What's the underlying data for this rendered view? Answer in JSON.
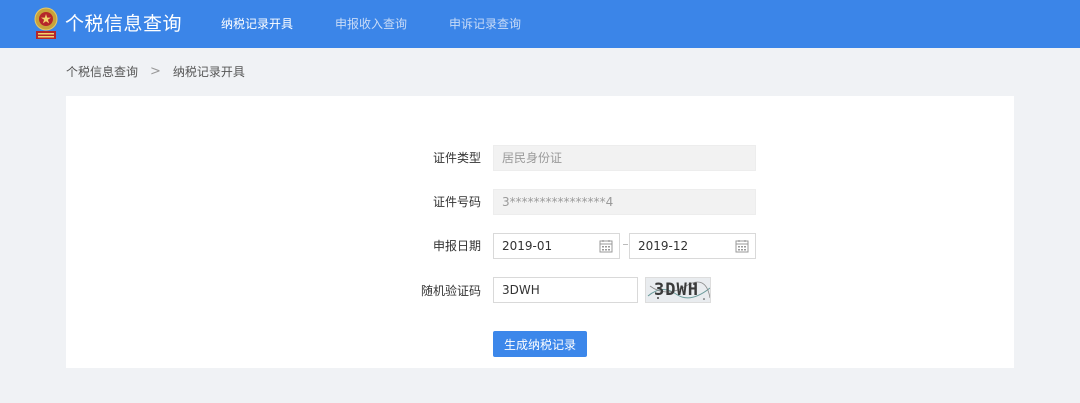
{
  "header": {
    "app_title": "个税信息查询",
    "nav": [
      {
        "label": "纳税记录开具",
        "active": true
      },
      {
        "label": "申报收入查询",
        "active": false
      },
      {
        "label": "申诉记录查询",
        "active": false
      }
    ],
    "logo_icon": "tax-emblem-icon",
    "bar_color": "#3b85e8"
  },
  "breadcrumb": {
    "items": [
      "个税信息查询",
      "纳税记录开具"
    ],
    "separator": ">"
  },
  "form": {
    "id_type": {
      "label": "证件类型",
      "value": "居民身份证"
    },
    "id_number": {
      "label": "证件号码",
      "value": "3****************4"
    },
    "period": {
      "label": "申报日期",
      "start": "2019-01",
      "end": "2019-12",
      "icon": "calendar-icon"
    },
    "captcha": {
      "label": "随机验证码",
      "value": "3DWH",
      "image_text": "3DWH"
    },
    "submit_label": "生成纳税记录"
  }
}
